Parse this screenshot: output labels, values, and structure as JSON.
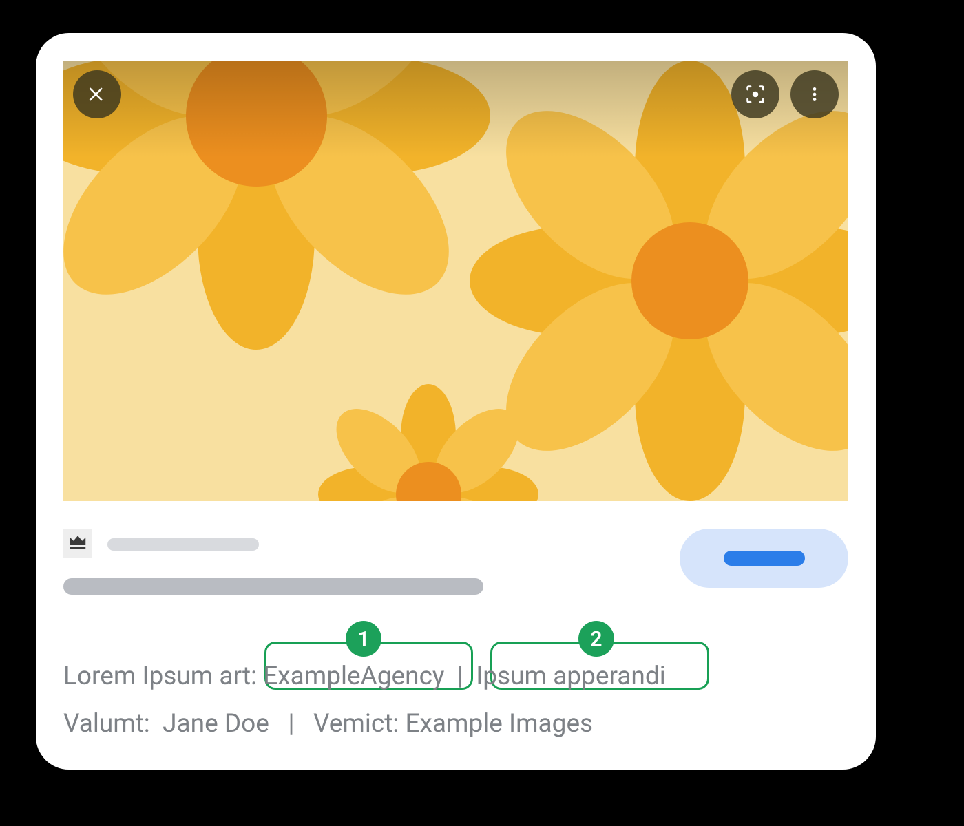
{
  "overlay": {
    "close_icon": "close-icon",
    "lens_icon": "lens-icon",
    "more_icon": "more-vert-icon"
  },
  "credits": {
    "label_art": "Lorem Ipsum art:",
    "agency": "ExampleAgency",
    "apperandi": "Ipsum apperandi",
    "label_valumt": "Valumt:",
    "valumt_value": "Jane Doe",
    "label_vemict": "Vemict:",
    "vemict_value": "Example Images",
    "separator": "|"
  },
  "annotations": {
    "badge1": "1",
    "badge2": "2"
  },
  "colors": {
    "petal_dark": "#f2b32a",
    "petal_light": "#f7c24a",
    "flower_center": "#ec8f1f",
    "image_bg": "#f8e0a0",
    "annotation_green": "#1ca15a",
    "cta_bg": "#d6e4fb",
    "cta_bar": "#2b7de9"
  }
}
